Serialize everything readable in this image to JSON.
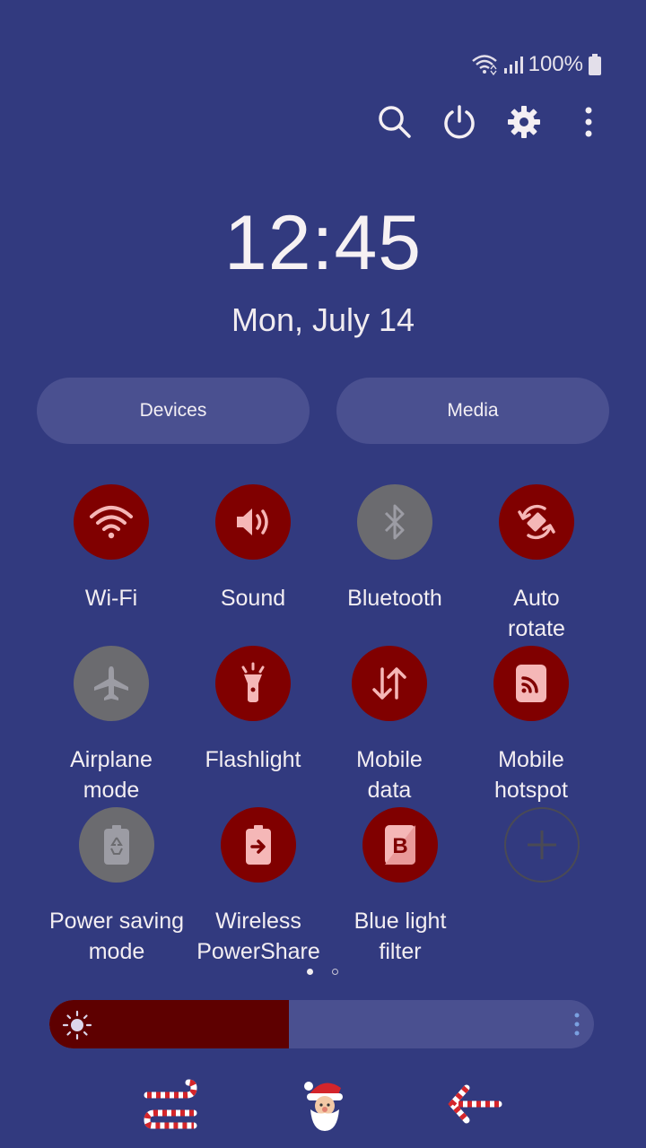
{
  "status_bar": {
    "battery_percent": "100%"
  },
  "top_actions": [
    {
      "name": "search-icon"
    },
    {
      "name": "power-icon"
    },
    {
      "name": "gear-icon"
    },
    {
      "name": "more-vertical-icon"
    }
  ],
  "clock": {
    "time": "12:45",
    "date": "Mon, July 14"
  },
  "panels": {
    "devices_label": "Devices",
    "media_label": "Media"
  },
  "tiles": [
    {
      "label": "Wi-Fi",
      "state": "on",
      "icon": "wifi-icon"
    },
    {
      "label": "Sound",
      "state": "on",
      "icon": "volume-icon"
    },
    {
      "label": "Bluetooth",
      "state": "off",
      "icon": "bluetooth-icon"
    },
    {
      "label_line1": "Auto",
      "label_line2": "rotate",
      "state": "on",
      "icon": "rotate-icon"
    },
    {
      "label_line1": "Airplane",
      "label_line2": "mode",
      "state": "off",
      "icon": "airplane-icon"
    },
    {
      "label": "Flashlight",
      "state": "on",
      "icon": "flashlight-icon"
    },
    {
      "label_line1": "Mobile",
      "label_line2": "data",
      "state": "on",
      "icon": "mobile-data-icon"
    },
    {
      "label_line1": "Mobile",
      "label_line2": "hotspot",
      "state": "on",
      "icon": "hotspot-icon"
    },
    {
      "label_line1": "Power saving",
      "label_line2": "mode",
      "state": "off",
      "icon": "power-saving-icon"
    },
    {
      "label_line1": "Wireless",
      "label_line2": "PowerShare",
      "state": "on",
      "icon": "wireless-powershare-icon"
    },
    {
      "label_line1": "Blue light",
      "label_line2": "filter",
      "state": "on",
      "icon": "blue-light-filter-icon"
    },
    {
      "label": "",
      "state": "add",
      "icon": "add-icon"
    }
  ],
  "pager": {
    "pages": 2,
    "current": 1
  },
  "brightness": {
    "level": 0.44
  },
  "colors": {
    "background": "#323a7f",
    "tile_on": "#800000",
    "tile_off": "#6b6b6f",
    "pill": "#4a5090",
    "brightness_fill": "#5e0000"
  },
  "bottom_decorations": [
    "candy-cane-icon",
    "santa-icon",
    "candy-cane-arrow-icon"
  ]
}
